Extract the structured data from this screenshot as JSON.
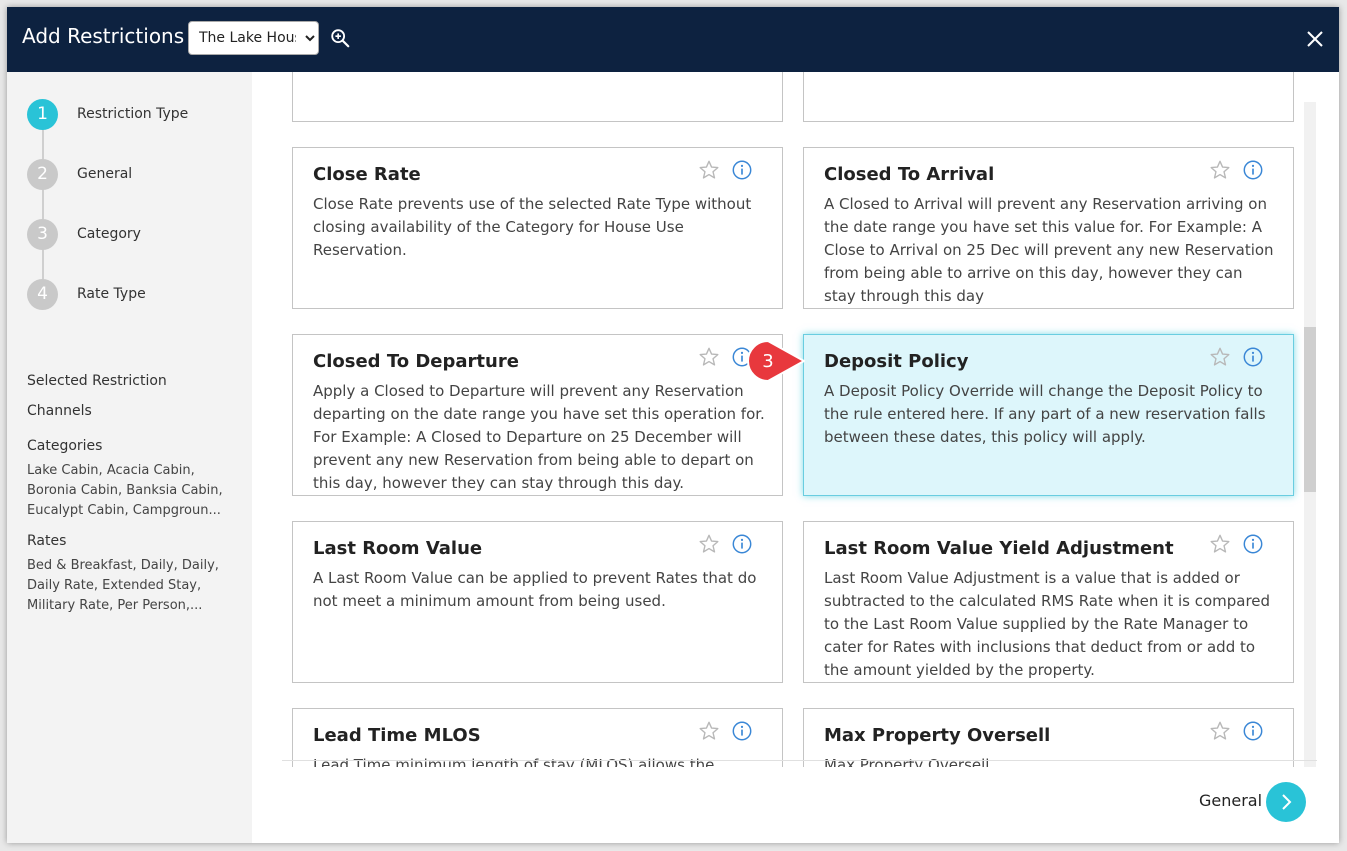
{
  "header": {
    "title": "Add Restrictions",
    "property_select": {
      "value": "The Lake House"
    }
  },
  "steps": [
    {
      "num": "1",
      "label": "Restriction Type",
      "active": true
    },
    {
      "num": "2",
      "label": "General",
      "active": false
    },
    {
      "num": "3",
      "label": "Category",
      "active": false
    },
    {
      "num": "4",
      "label": "Rate Type",
      "active": false
    }
  ],
  "summary": {
    "heading": "Selected Restriction",
    "channels_label": "Channels",
    "categories_label": "Categories",
    "categories_text": "Lake Cabin, Acacia Cabin, Boronia Cabin, Banksia Cabin, Eucalypt Cabin, Campgroun...",
    "rates_label": "Rates",
    "rates_text": "Bed & Breakfast, Daily, Daily, Daily Rate, Extended Stay, Military Rate, Per Person,..."
  },
  "restriction_cards": [
    {
      "title": "Close Rate",
      "description": "Close Rate prevents use of the selected Rate Type without closing availability of the Category for House Use Reservation."
    },
    {
      "title": "Closed To Arrival",
      "description": "A Closed to Arrival will prevent any Reservation arriving on the date range you have set this value for. For Example: A Close to Arrival on 25 Dec will prevent any new Reservation from being able to arrive on this day, however they can stay through this day"
    },
    {
      "title": "Closed To Departure",
      "description": "Apply a Closed to Departure will prevent any Reservation departing on the date range you have set this operation for. For Example: A Closed to Departure on 25 December will prevent any new Reservation from being able to depart on this day, however they can stay through this day."
    },
    {
      "title": "Deposit Policy",
      "description": "A Deposit Policy Override will change the Deposit Policy to the rule entered here. If any part of a new reservation falls between these dates, this policy will apply.",
      "selected": true
    },
    {
      "title": "Last Room Value",
      "description": "A Last Room Value can be applied to prevent Rates that do not meet a minimum amount from being used."
    },
    {
      "title": "Last Room Value Yield Adjustment",
      "description": "Last Room Value Adjustment is a value that is added or subtracted to the calculated RMS Rate when it is compared to the Last Room Value supplied by the Rate Manager to cater for Rates with inclusions that deduct from or add to the amount yielded by the property."
    },
    {
      "title": "Lead Time MLOS",
      "description": "Lead Time minimum length of stay (MLOS) allows the length"
    },
    {
      "title": "Max Property Oversell",
      "description": "Max Property Oversell..."
    }
  ],
  "callout": {
    "number": "3"
  },
  "footer": {
    "next_label": "General"
  },
  "colors": {
    "header_bg": "#0d2240",
    "accent": "#29c3d7",
    "selected_card_bg": "#ddf6fb",
    "callout": "#e8383d"
  },
  "icons": {
    "search": "zoom-in-icon",
    "close": "close-icon",
    "star": "star-outline-icon",
    "info": "info-circle-icon",
    "next": "chevron-right-icon"
  }
}
